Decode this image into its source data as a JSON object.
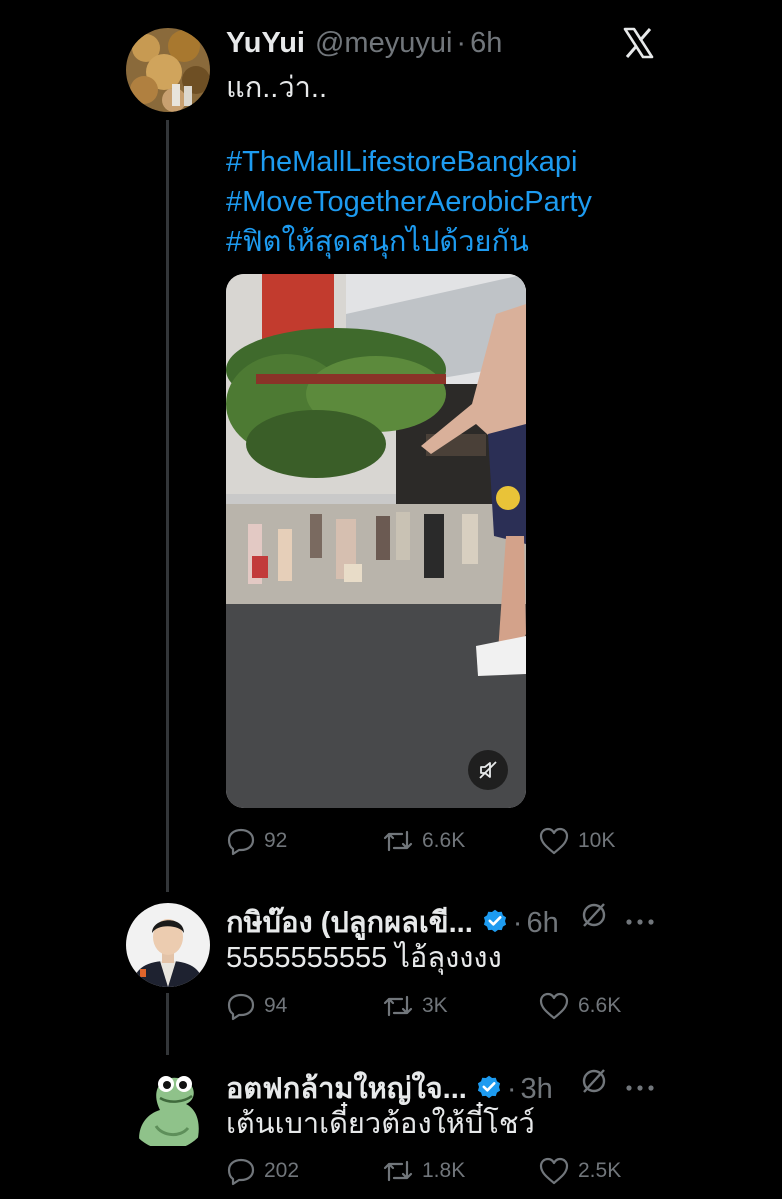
{
  "colors": {
    "background": "#000000",
    "text": "#e7e9ea",
    "muted": "#71767b",
    "link": "#1d9bf0",
    "verified": "#1d9bf0"
  },
  "main_post": {
    "display_name": "YuYui",
    "handle": "@meyuyui",
    "separator": "·",
    "time": "6h",
    "text": "แก..ว่า..",
    "hashtags": [
      "#TheMallLifestoreBangkapi",
      "#MoveTogetherAerobicParty",
      "#ฟิตให้สุดสนุกไปด้วยกัน"
    ],
    "media": {
      "type": "video",
      "muted": true
    },
    "replies": "92",
    "reposts": "6.6K",
    "likes": "10K",
    "top_right_icon": "x-logo-icon"
  },
  "replies": [
    {
      "display_name": "กษิบ๊อง (ปลูกผลเขี...",
      "verified": true,
      "separator": "·",
      "time": "6h",
      "text": "5555555555 ไอ้ลุงงงง",
      "replies": "94",
      "reposts": "3K",
      "likes": "6.6K"
    },
    {
      "display_name": "อตฟกล้ามใหญ่ใจ...",
      "verified": true,
      "separator": "·",
      "time": "3h",
      "text": "เต้นเบาเดี๋ยวต้องให้บี๋โชว์",
      "replies": "202",
      "reposts": "1.8K",
      "likes": "2.5K"
    }
  ]
}
